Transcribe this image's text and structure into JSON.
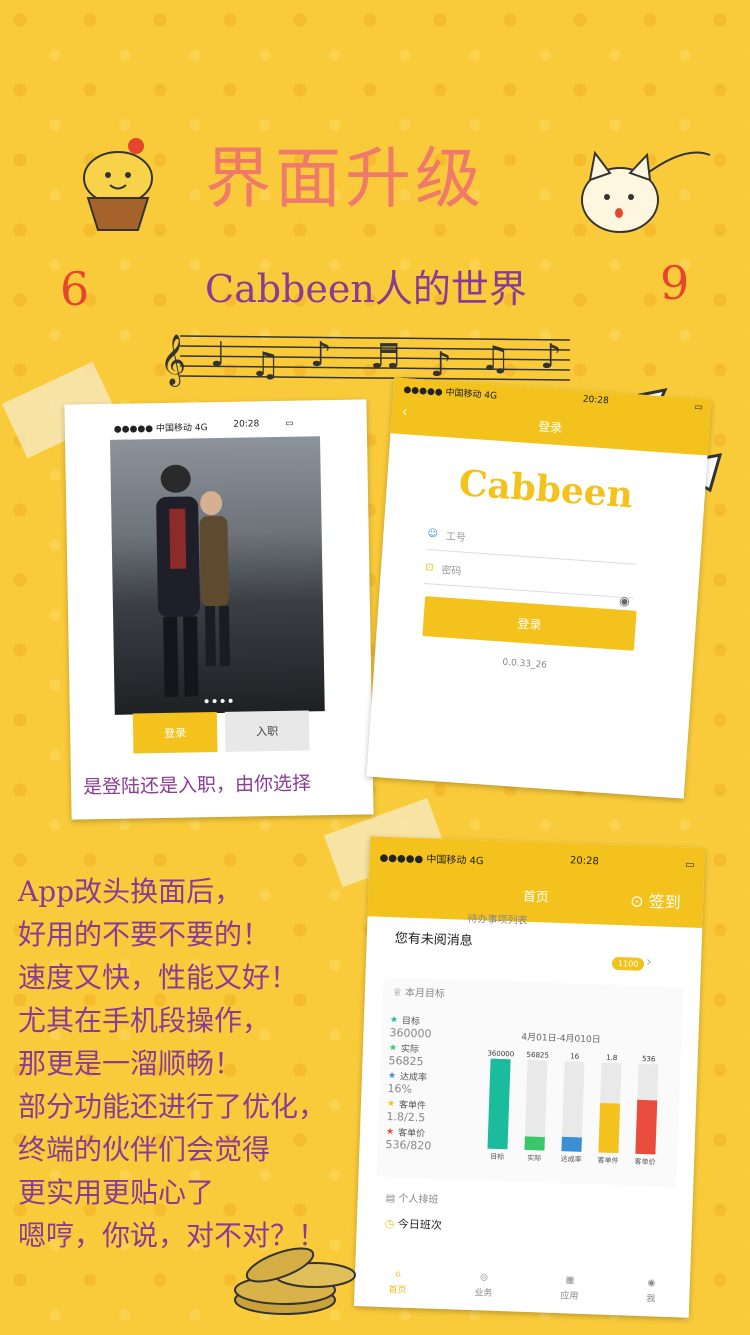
{
  "title": "界面升级",
  "subtitle": "Cabbeen人的世界",
  "swirl_left": "6",
  "swirl_right": "9",
  "card1": {
    "status_carrier": "●●●●● 中国移动 4G",
    "status_time": "20:28",
    "login_label": "登录",
    "join_label": "入职",
    "caption": "是登陆还是入职，由你选择"
  },
  "card2": {
    "status_carrier": "●●●●● 中国移动 4G",
    "status_time": "20:28",
    "screen_title": "登录",
    "logo": "Cabbeen",
    "id_placeholder": "工号",
    "password_placeholder": "密码",
    "login_label": "登录",
    "version": "0.0.33_26"
  },
  "card3": {
    "status_carrier": "●●●●● 中国移动 4G",
    "status_time": "20:28",
    "home_title": "首页",
    "sign_label": "签到",
    "todo_header": "待办事项列表",
    "unread_message": "您有未阅消息",
    "unread_count": "1100",
    "monthly_target": "本月目标",
    "date_range": "4月01日-4月010日",
    "stats": [
      {
        "label": "目标",
        "value": "360000",
        "color": "#1bbc9b"
      },
      {
        "label": "实际",
        "value": "56825",
        "color": "#3ac76a"
      },
      {
        "label": "达成率",
        "value": "16%",
        "color": "#3a8fd6"
      },
      {
        "label": "客单件",
        "value": "1.8/2.5",
        "color": "#f3c21c"
      },
      {
        "label": "客单价",
        "value": "536/820",
        "color": "#e74c3c"
      }
    ],
    "personal_rank": "个人排班",
    "today_shift": "今日班次",
    "nav": [
      "首页",
      "业务",
      "应用",
      "我"
    ]
  },
  "chart_data": {
    "type": "bar",
    "categories": [
      "目标",
      "实际",
      "达成率",
      "客单件",
      "客单价"
    ],
    "value_labels": [
      "360000",
      "56825",
      "16",
      "1.8",
      "536"
    ],
    "fill_fraction": [
      1.0,
      0.15,
      0.16,
      0.55,
      0.6
    ],
    "colors": [
      "#1bbc9b",
      "#3ac76a",
      "#3a8fd6",
      "#f3c21c",
      "#e74c3c"
    ]
  },
  "poem": [
    "App改头换面后，",
    "好用的不要不要的！",
    "速度又快，性能又好！",
    "尤其在手机段操作，",
    "那更是一溜顺畅！",
    "部分功能还进行了优化，",
    "终端的伙伴们会觉得",
    "更实用更贴心了",
    "嗯哼，你说，对不对？！"
  ]
}
